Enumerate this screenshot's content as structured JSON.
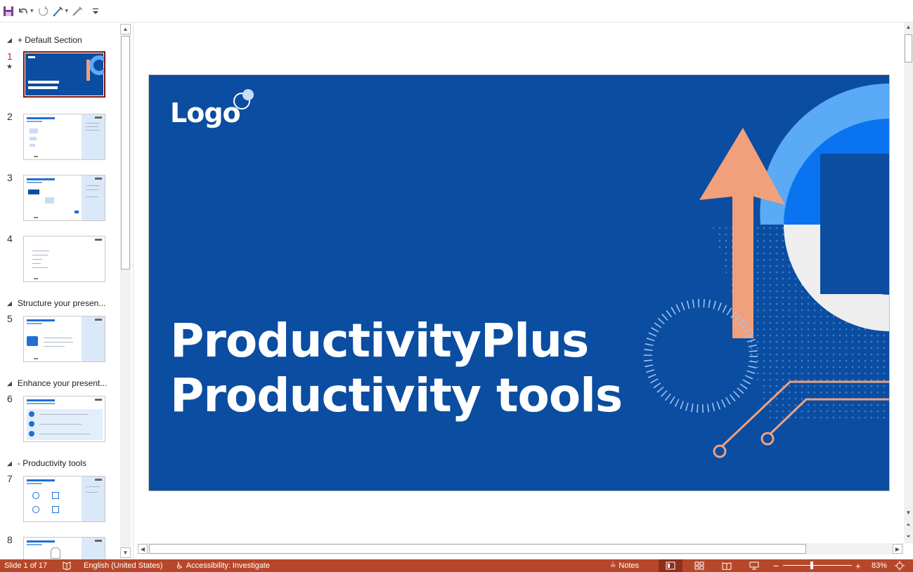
{
  "toolbar": {
    "save_icon": "save-icon",
    "undo_icon": "undo-icon",
    "redo_icon": "redo-icon",
    "draw_icon": "draw-icon",
    "customize_icon": "customize-toolbar-icon"
  },
  "sections": [
    {
      "label": "+ Default Section"
    },
    {
      "label": "Structure your presen..."
    },
    {
      "label": "Enhance your present..."
    },
    {
      "label": "- Productivity tools"
    }
  ],
  "slides": [
    {
      "number": "1"
    },
    {
      "number": "2"
    },
    {
      "number": "3"
    },
    {
      "number": "4"
    },
    {
      "number": "5"
    },
    {
      "number": "6"
    },
    {
      "number": "7"
    },
    {
      "number": "8"
    }
  ],
  "slide": {
    "logo_text": "Logo",
    "title_line1": "ProductivityPlus",
    "title_line2": "Productivity tools",
    "colors": {
      "background": "#0a4da1",
      "accent_orange": "#f2a07b",
      "ring_light": "#5aaaf5",
      "ring_mid": "#0a74f0",
      "ring_grey": "#eeeeee"
    }
  },
  "statusbar": {
    "slide_indicator": "Slide 1 of 17",
    "language": "English (United States)",
    "accessibility": "Accessibility: Investigate",
    "notes": "Notes",
    "zoom": "83%",
    "color": "#b7472a"
  }
}
